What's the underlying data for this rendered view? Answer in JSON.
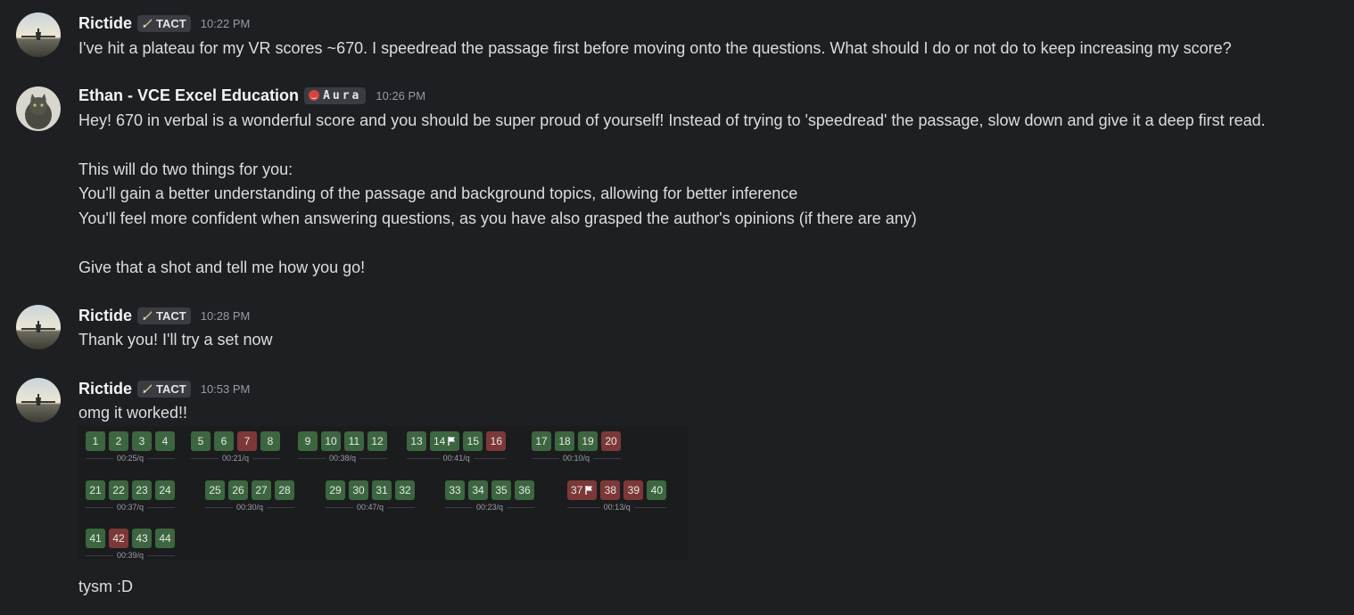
{
  "colors": {
    "background": "#1e1f22",
    "correct": "#3c6640",
    "wrong": "#7c3838",
    "username": "#f2f3f5",
    "timestamp": "#949ba4"
  },
  "messages": [
    {
      "author": "Rictide",
      "avatar": "airplane-sunset-avatar",
      "tag": {
        "icon": "sword-icon",
        "label": "TACT"
      },
      "timestamp": "10:22 PM",
      "lines": [
        "I've hit a plateau for my VR scores ~670. I speedread the passage first before moving onto the questions. What should I do or not do to keep increasing my score?"
      ]
    },
    {
      "author": "Ethan - VCE Excel Education",
      "avatar": "cat-avatar",
      "tag": {
        "icon": "red-orb-icon",
        "label": "Aura"
      },
      "timestamp": "10:26 PM",
      "lines": [
        "Hey! 670 in verbal is a wonderful score and you should be super proud of yourself! Instead of trying to 'speedread' the passage, slow down and give it a deep first read.",
        "This will do two things for you:",
        "You'll gain a better understanding of the passage and background topics, allowing for better inference",
        "You'll feel more confident when answering questions, as you have also grasped the author's opinions (if there are any)",
        "Give that a shot and tell me how you go!"
      ]
    },
    {
      "author": "Rictide",
      "avatar": "airplane-sunset-avatar",
      "tag": {
        "icon": "sword-icon",
        "label": "TACT"
      },
      "timestamp": "10:28 PM",
      "lines": [
        "Thank you! I'll try a set now"
      ]
    },
    {
      "author": "Rictide",
      "avatar": "airplane-sunset-avatar",
      "tag": {
        "icon": "sword-icon",
        "label": "TACT"
      },
      "timestamp": "10:53 PM",
      "lines": [
        "omg it worked!!",
        "tysm :D"
      ]
    }
  ],
  "results": {
    "groups": [
      {
        "time": "00:25/q",
        "questions": [
          {
            "n": "1",
            "status": "correct"
          },
          {
            "n": "2",
            "status": "correct"
          },
          {
            "n": "3",
            "status": "correct"
          },
          {
            "n": "4",
            "status": "correct"
          }
        ]
      },
      {
        "time": "00:21/q",
        "questions": [
          {
            "n": "5",
            "status": "correct"
          },
          {
            "n": "6",
            "status": "correct"
          },
          {
            "n": "7",
            "status": "wrong"
          },
          {
            "n": "8",
            "status": "correct"
          }
        ]
      },
      {
        "time": "00:38/q",
        "questions": [
          {
            "n": "9",
            "status": "correct"
          },
          {
            "n": "10",
            "status": "correct"
          },
          {
            "n": "11",
            "status": "correct"
          },
          {
            "n": "12",
            "status": "correct"
          }
        ]
      },
      {
        "time": "00:41/q",
        "questions": [
          {
            "n": "13",
            "status": "correct"
          },
          {
            "n": "14",
            "status": "correct",
            "flagged": true
          },
          {
            "n": "15",
            "status": "correct"
          },
          {
            "n": "16",
            "status": "wrong"
          }
        ]
      },
      {
        "time": "00:10/q",
        "questions": [
          {
            "n": "17",
            "status": "correct"
          },
          {
            "n": "18",
            "status": "correct"
          },
          {
            "n": "19",
            "status": "correct"
          },
          {
            "n": "20",
            "status": "wrong"
          }
        ]
      },
      {
        "time": "00:37/q",
        "questions": [
          {
            "n": "21",
            "status": "correct"
          },
          {
            "n": "22",
            "status": "correct"
          },
          {
            "n": "23",
            "status": "correct"
          },
          {
            "n": "24",
            "status": "correct"
          }
        ]
      },
      {
        "time": "00:30/q",
        "questions": [
          {
            "n": "25",
            "status": "correct"
          },
          {
            "n": "26",
            "status": "correct"
          },
          {
            "n": "27",
            "status": "correct"
          },
          {
            "n": "28",
            "status": "correct"
          }
        ]
      },
      {
        "time": "00:47/q",
        "questions": [
          {
            "n": "29",
            "status": "correct"
          },
          {
            "n": "30",
            "status": "correct"
          },
          {
            "n": "31",
            "status": "correct"
          },
          {
            "n": "32",
            "status": "correct"
          }
        ]
      },
      {
        "time": "00:23/q",
        "questions": [
          {
            "n": "33",
            "status": "correct"
          },
          {
            "n": "34",
            "status": "correct"
          },
          {
            "n": "35",
            "status": "correct"
          },
          {
            "n": "36",
            "status": "correct"
          }
        ]
      },
      {
        "time": "00:13/q",
        "questions": [
          {
            "n": "37",
            "status": "wrong",
            "flagged": true
          },
          {
            "n": "38",
            "status": "wrong"
          },
          {
            "n": "39",
            "status": "wrong"
          },
          {
            "n": "40",
            "status": "correct"
          }
        ]
      },
      {
        "time": "00:39/q",
        "questions": [
          {
            "n": "41",
            "status": "correct"
          },
          {
            "n": "42",
            "status": "wrong"
          },
          {
            "n": "43",
            "status": "correct"
          },
          {
            "n": "44",
            "status": "correct"
          }
        ]
      }
    ]
  }
}
